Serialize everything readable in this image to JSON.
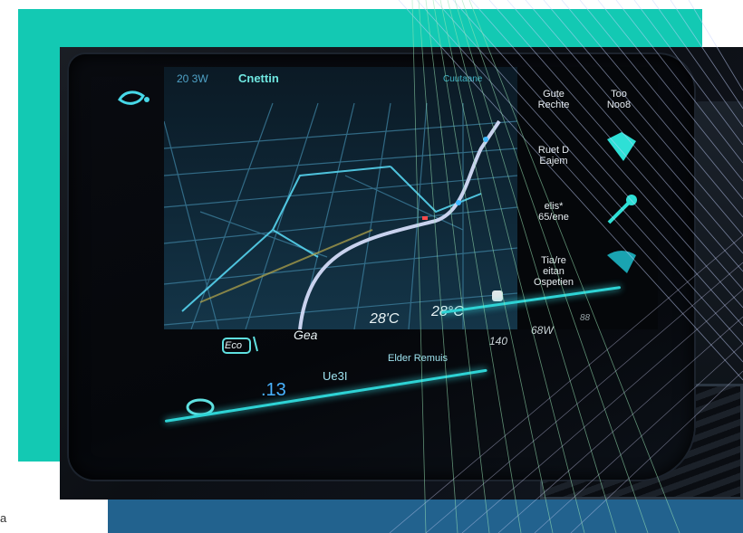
{
  "colors": {
    "teal": "#13c9b3",
    "blue": "#22628e",
    "cyan": "#2ed3d5"
  },
  "corner_letter": "a",
  "screen": {
    "top_left": "20 3W",
    "title": "Cnettin",
    "top_right": "Cuutaane"
  },
  "side_panel": {
    "items": [
      {
        "label1": "Gute",
        "label2": "Rechte"
      },
      {
        "label1": "Too",
        "label2": "Noo8"
      },
      {
        "label1": "Ruet D",
        "label2": "Eajem"
      },
      {
        "label1": "elis*",
        "label2": "65/ene"
      },
      {
        "label1": "Tia/re",
        "label2": "eitan",
        "label3": "Ospetien"
      }
    ]
  },
  "modes": {
    "eco": "Eco",
    "gear": "Gea",
    "temp_left": "28'C",
    "temp_right": "28°C",
    "status1": "140",
    "status2": "68W",
    "status3": "88"
  },
  "bottom": {
    "num": ".13",
    "tab1": "Ue3I",
    "tab2": "Elder Remuis"
  },
  "icons": [
    "leaf-icon",
    "warning-icon",
    "nav-arrow-icon",
    "wrench-icon",
    "wiper-icon",
    "seat-icon",
    "cloud-icon"
  ]
}
